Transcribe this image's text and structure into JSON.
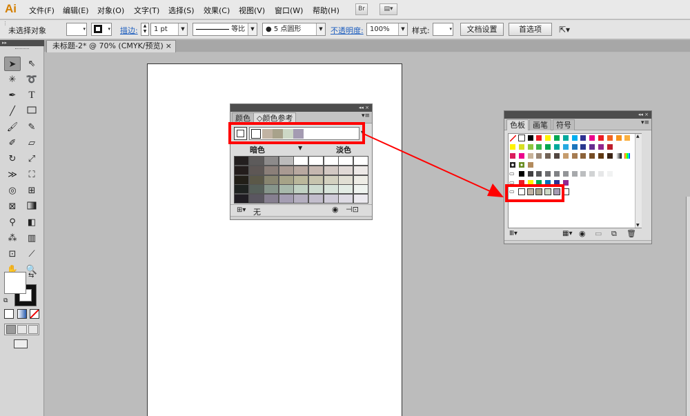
{
  "app": {
    "logo": "Ai"
  },
  "menu": [
    "文件(F)",
    "编辑(E)",
    "对象(O)",
    "文字(T)",
    "选择(S)",
    "效果(C)",
    "视图(V)",
    "窗口(W)",
    "帮助(H)"
  ],
  "menu_buttons": {
    "bridge": "Br",
    "arrange": "▤▾"
  },
  "control": {
    "selection": "未选择对象",
    "stroke_label": "描边:",
    "stroke_weight": "1 pt",
    "stroke_profile": "等比",
    "brush": "● 5 点圆形",
    "opacity_label": "不透明度:",
    "opacity": "100%",
    "style_label": "样式:",
    "doc_setup": "文档设置",
    "preferences": "首选项",
    "arrow": "▾"
  },
  "document": {
    "tab": "未标题-2* @ 70% (CMYK/预览)",
    "close": "×"
  },
  "color_guide": {
    "tab_color": "颜色",
    "tab_guide": "◇颜色参考",
    "shades": "暗色",
    "tints": "淡色",
    "none": "无",
    "collapse": "◂◂  ×",
    "harmony": [
      "#c1b3a3",
      "#a8a28b",
      "#cdd8c6",
      "#a49bb2"
    ],
    "grid": [
      [
        "#231f1f",
        "#5d5b5b",
        "#8d8b8b",
        "#bcbbbb",
        "#ffffff",
        "#ffffff",
        "#ffffff",
        "#ffffff",
        "#ffffff"
      ],
      [
        "#231d1c",
        "#5e5755",
        "#8b7f79",
        "#a99a92",
        "#b8a8a0",
        "#c5b7b0",
        "#d2c8c3",
        "#e0d9d6",
        "#ede9e7"
      ],
      [
        "#221f18",
        "#5b5848",
        "#888570",
        "#a6a388",
        "#bab79b",
        "#c7c4ae",
        "#d3d1c0",
        "#e1dfd4",
        "#eeede6"
      ],
      [
        "#1e2220",
        "#56605a",
        "#86958b",
        "#a8b9ac",
        "#c1d2c4",
        "#cddbd0",
        "#d8e4db",
        "#e3ece5",
        "#eff4f0"
      ],
      [
        "#201d23",
        "#5a5660",
        "#867f90",
        "#a49db2",
        "#b5afc0",
        "#c2bdcc",
        "#cfcbd8",
        "#dddae3",
        "#ebe9ef"
      ]
    ]
  },
  "swatches": {
    "tab_swatches": "色板",
    "tab_brushes": "画笔",
    "tab_symbols": "符号",
    "collapse": "◂◂  ×",
    "menu": "▾≡",
    "row1": [
      "#000000",
      "#ed1c24",
      "#fff200",
      "#00a651",
      "#00a99d",
      "#00aeef",
      "#2e3192",
      "#ec008c",
      "#ed1c24",
      "#f26522",
      "#f7941d",
      "#fbb040"
    ],
    "row2": [
      "#fff200",
      "#d7df23",
      "#8dc63f",
      "#39b54a",
      "#00a651",
      "#00a99d",
      "#27aae1",
      "#1c75bc",
      "#2b3990",
      "#662d91",
      "#92278f",
      "#be1e2d"
    ],
    "row3": [
      "#da1c5c",
      "#ec008c",
      "#c7b299",
      "#998675",
      "#736357",
      "#534741",
      "#c69c6d",
      "#a67c52",
      "#8c6239",
      "#754c24",
      "#603913",
      "#3c2415"
    ],
    "row5": [
      "#000000",
      "#414042",
      "#58595b",
      "#6d6e71",
      "#808285",
      "#939598",
      "#a7a9ac",
      "#bcbec0",
      "#d1d3d4",
      "#e6e7e8",
      "#f1f2f2"
    ],
    "row6": [
      "#ed1c24",
      "#fff200",
      "#00a651",
      "#0072bc",
      "#2e3192",
      "#92278f"
    ],
    "row7": [
      "#ffffff",
      "#c1b3a3",
      "#a8a28b",
      "#cdd8c6",
      "#a49bb2",
      "#ffffff"
    ]
  }
}
